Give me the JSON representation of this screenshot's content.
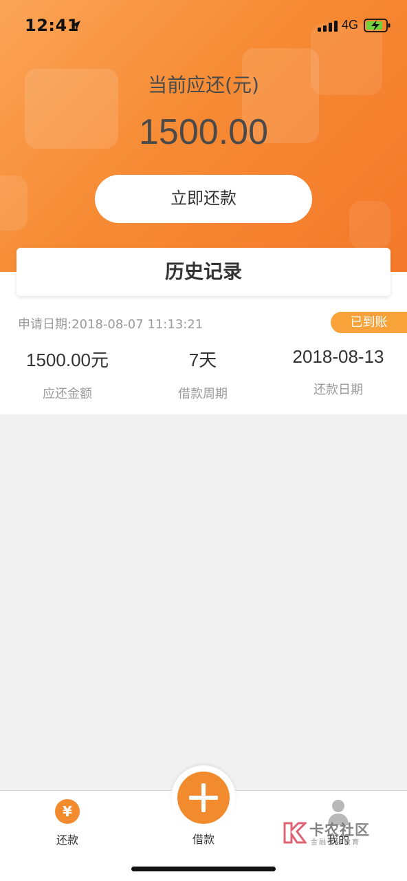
{
  "status_bar": {
    "time": "12:41",
    "network": "4G"
  },
  "header": {
    "due_label": "当前应还(元)",
    "due_amount": "1500.00",
    "pay_button": "立即还款"
  },
  "history": {
    "title": "历史记录",
    "records": [
      {
        "apply_date": "申请日期:2018-08-07 11:13:21",
        "status": "已到账",
        "amount": "1500.00元",
        "amount_label": "应还金额",
        "period": "7天",
        "period_label": "借款周期",
        "repay_date": "2018-08-13",
        "repay_date_label": "还款日期"
      }
    ]
  },
  "tabbar": {
    "left_label": "还款",
    "center_label": "借款",
    "right_label": "我的",
    "yen_symbol": "¥"
  },
  "watermark": {
    "title": "卡农社区",
    "subtitle": "金融在线教育"
  },
  "colors": {
    "accent": "#f28a2e",
    "badge": "#f7a33a"
  },
  "icons": [
    "location-arrow-icon",
    "signal-icon",
    "battery-charging-icon",
    "yen-icon",
    "plus-icon",
    "user-icon"
  ]
}
